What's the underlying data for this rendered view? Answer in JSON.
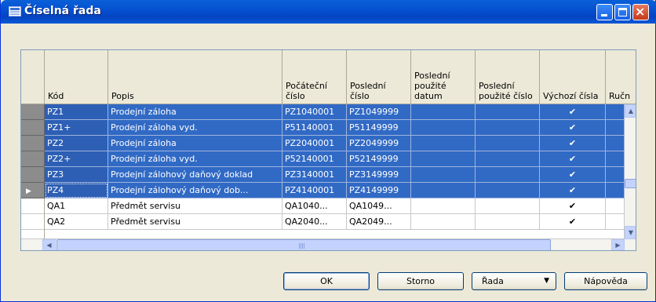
{
  "window": {
    "title": "Číselná řada"
  },
  "grid": {
    "columns": [
      {
        "label": "Kód"
      },
      {
        "label": "Popis"
      },
      {
        "label": "Počáteční číslo"
      },
      {
        "label": "Poslední číslo"
      },
      {
        "label": "Poslední použité datum"
      },
      {
        "label": "Poslední použité číslo"
      },
      {
        "label": "Výchozí čísla"
      },
      {
        "label": "Ručn"
      }
    ],
    "rows": [
      {
        "code": "PZ1",
        "desc": "Prodejní záloha",
        "start": "PZ1040001",
        "end": "PZ1049999",
        "last_date": "",
        "last_no": "",
        "default": "✔",
        "manual": "",
        "selected": true
      },
      {
        "code": "PZ1+",
        "desc": "Prodejní záloha vyd.",
        "start": "P51140001",
        "end": "P51149999",
        "last_date": "",
        "last_no": "",
        "default": "✔",
        "manual": "",
        "selected": true
      },
      {
        "code": "PZ2",
        "desc": "Prodejní záloha",
        "start": "PZ2040001",
        "end": "PZ2049999",
        "last_date": "",
        "last_no": "",
        "default": "✔",
        "manual": "",
        "selected": true
      },
      {
        "code": "PZ2+",
        "desc": "Prodejní záloha vyd.",
        "start": "P52140001",
        "end": "P52149999",
        "last_date": "",
        "last_no": "",
        "default": "✔",
        "manual": "",
        "selected": true
      },
      {
        "code": "PZ3",
        "desc": "Prodejní zálohový daňový doklad",
        "start": "PZ3140001",
        "end": "PZ3149999",
        "last_date": "",
        "last_no": "",
        "default": "✔",
        "manual": "",
        "selected": true
      },
      {
        "code": "PZ4",
        "desc": "Prodejní zálohový daňový dob...",
        "start": "PZ4140001",
        "end": "PZ4149999",
        "last_date": "",
        "last_no": "",
        "default": "✔",
        "manual": "",
        "selected": true,
        "current": true
      },
      {
        "code": "QA1",
        "desc": "Předmět servisu",
        "start": "QA1040...",
        "end": "QA1049...",
        "last_date": "",
        "last_no": "",
        "default": "✔",
        "manual": "",
        "selected": false
      },
      {
        "code": "QA2",
        "desc": "Předmět servisu",
        "start": "QA2040...",
        "end": "QA2049...",
        "last_date": "",
        "last_no": "",
        "default": "✔",
        "manual": "",
        "selected": false
      }
    ],
    "current_row_marker": "▶"
  },
  "scroll": {
    "up": "▲",
    "down": "▼",
    "left": "◀",
    "right": "▶"
  },
  "buttons": {
    "ok": "OK",
    "storno": "Storno",
    "rada": "Řada",
    "rada_arrow": "▼",
    "help": "Nápověda"
  }
}
